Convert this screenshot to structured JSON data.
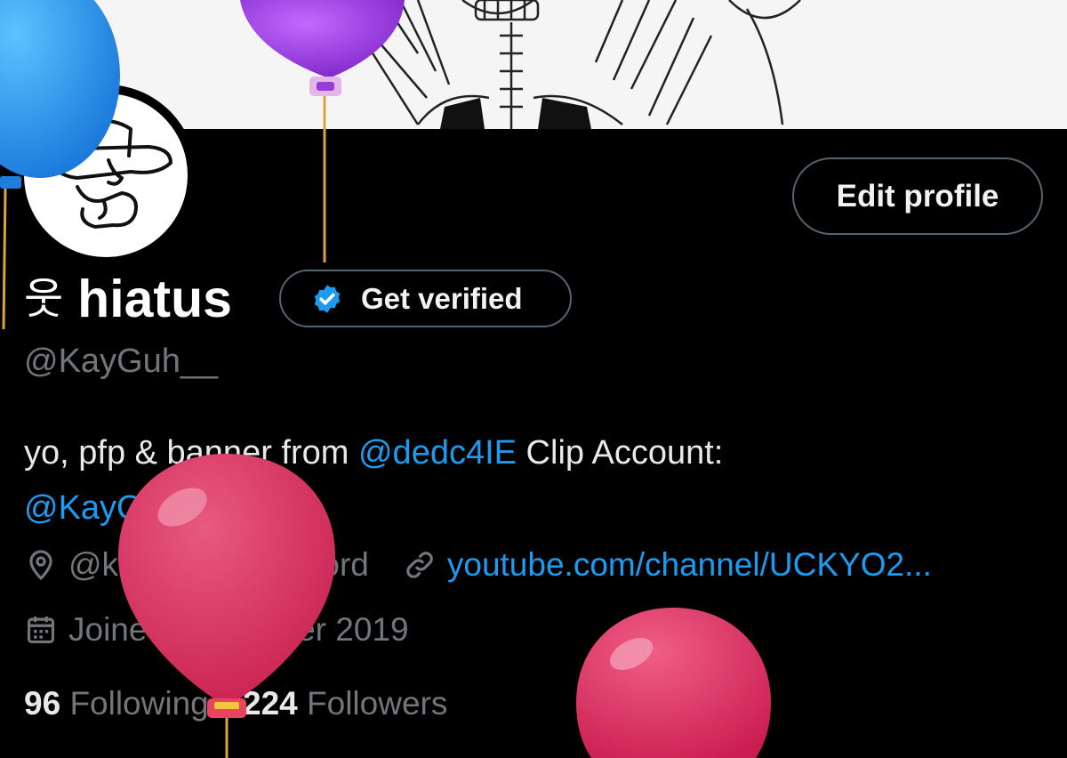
{
  "profile": {
    "display_name_symbol": "웃",
    "display_name": "hiatus",
    "verify_label": "Get verified",
    "handle": "@KayGuh__",
    "edit_label": "Edit profile"
  },
  "bio": {
    "prefix": "yo, pfp & banner from ",
    "mention1": "@dedc4IE",
    "middle": " Clip Account: ",
    "mention2": "@KayGuhClip"
  },
  "meta": {
    "location": "@kayguh on discord",
    "website": "youtube.com/channel/UCKYO2...",
    "joined": "Joined November 2019"
  },
  "stats": {
    "following_count": "96",
    "following_label": "Following",
    "followers_count": "224",
    "followers_label": "Followers"
  },
  "icons": {
    "location": "location-pin-icon",
    "website": "link-icon",
    "joined": "calendar-icon",
    "verified": "verified-badge-icon"
  },
  "colors": {
    "background": "#000000",
    "link": "#1d9bf0",
    "secondary_text": "#71767b",
    "balloon_blue": "#1e8fe8",
    "balloon_purple": "#9a3bd9",
    "balloon_pink": "#d93b63"
  }
}
